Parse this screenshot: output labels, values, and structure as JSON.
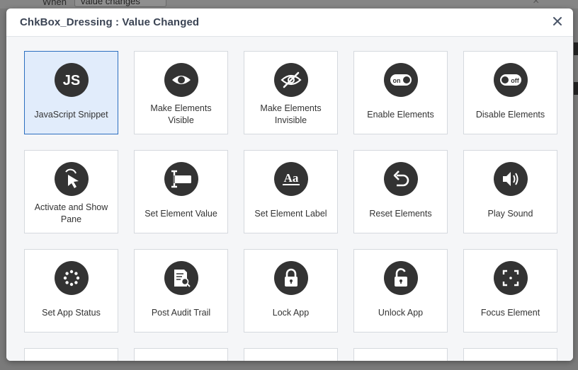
{
  "backdrop": {
    "when_label": "When",
    "when_value": "value changes",
    "close_glyph": "×"
  },
  "dialog": {
    "title": "ChkBox_Dressing : Value Changed",
    "close_icon": "close-icon"
  },
  "actions": [
    {
      "label": "JavaScript Snippet",
      "icon": "js-icon",
      "selected": true
    },
    {
      "label": "Make Elements Visible",
      "icon": "eye-icon"
    },
    {
      "label": "Make Elements Invisible",
      "icon": "eye-slash-icon"
    },
    {
      "label": "Enable Elements",
      "icon": "toggle-on-icon"
    },
    {
      "label": "Disable Elements",
      "icon": "toggle-off-icon"
    },
    {
      "label": "Activate and Show Pane",
      "icon": "cursor-click-icon"
    },
    {
      "label": "Set Element Value",
      "icon": "text-cursor-icon"
    },
    {
      "label": "Set Element Label",
      "icon": "font-label-icon"
    },
    {
      "label": "Reset Elements",
      "icon": "undo-icon"
    },
    {
      "label": "Play Sound",
      "icon": "speaker-icon"
    },
    {
      "label": "Set App Status",
      "icon": "spinner-icon"
    },
    {
      "label": "Post Audit Trail",
      "icon": "audit-document-icon"
    },
    {
      "label": "Lock App",
      "icon": "lock-icon"
    },
    {
      "label": "Unlock App",
      "icon": "unlock-icon"
    },
    {
      "label": "Focus Element",
      "icon": "focus-icon"
    }
  ],
  "icon_texts": {
    "js": "JS",
    "on": "on",
    "off": "off",
    "aa": "Aa"
  }
}
